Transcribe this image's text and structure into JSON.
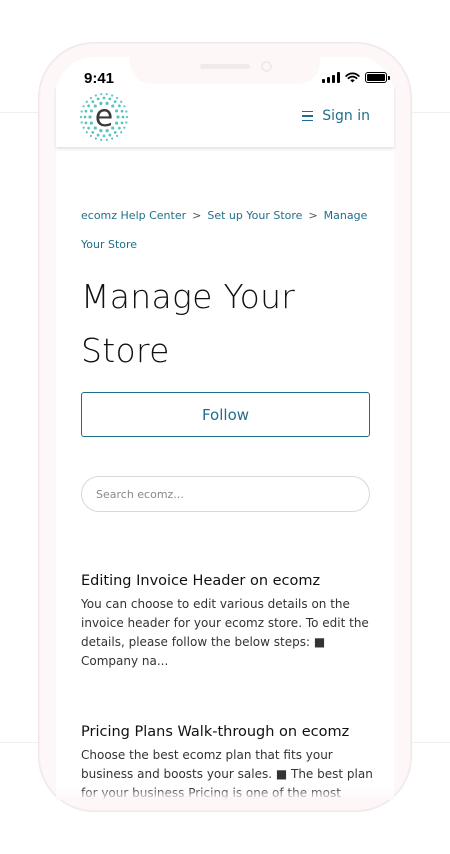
{
  "status_bar": {
    "time": "9:41"
  },
  "header": {
    "logo_letter": "e",
    "sign_in": "Sign in"
  },
  "breadcrumb": [
    "ecomz Help Center",
    "Set up Your Store",
    "Manage Your Store"
  ],
  "breadcrumb_separator": ">",
  "page_title_line1": "Manage Your",
  "page_title_line2": "Store",
  "follow_label": "Follow",
  "search": {
    "placeholder": "Search ecomz..."
  },
  "articles": [
    {
      "title": "Editing Invoice Header on ecomz",
      "snippet": "You can choose to edit various details on the invoice header for your ecomz store. To edit the details, please follow the below steps: ■ Company na..."
    },
    {
      "title": "Pricing Plans Walk-through on ecomz",
      "snippet": "Choose the best ecomz plan that fits your business and boosts your sales.  ■ The best plan for your business Pricing is one of the most"
    }
  ],
  "colors": {
    "accent": "#1f6f8b",
    "logo_dots": "#5bc4c0"
  }
}
